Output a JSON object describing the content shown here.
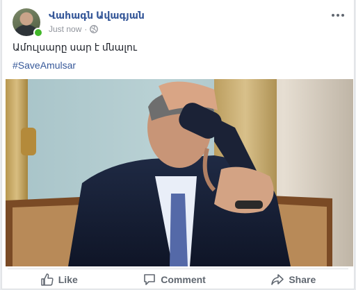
{
  "post": {
    "author": "Վահագն Ավագյան",
    "timestamp": "Just now",
    "separator": "·",
    "privacy_icon": "globe-icon",
    "text": "Ամուլսարը սար է մնալու",
    "hashtag": "#SaveAmulsar",
    "more_icon": "more-options-icon"
  },
  "actions": {
    "like_label": "Like",
    "comment_label": "Comment",
    "share_label": "Share"
  },
  "colors": {
    "link": "#365899",
    "secondary": "#606770",
    "online": "#42b72a"
  }
}
